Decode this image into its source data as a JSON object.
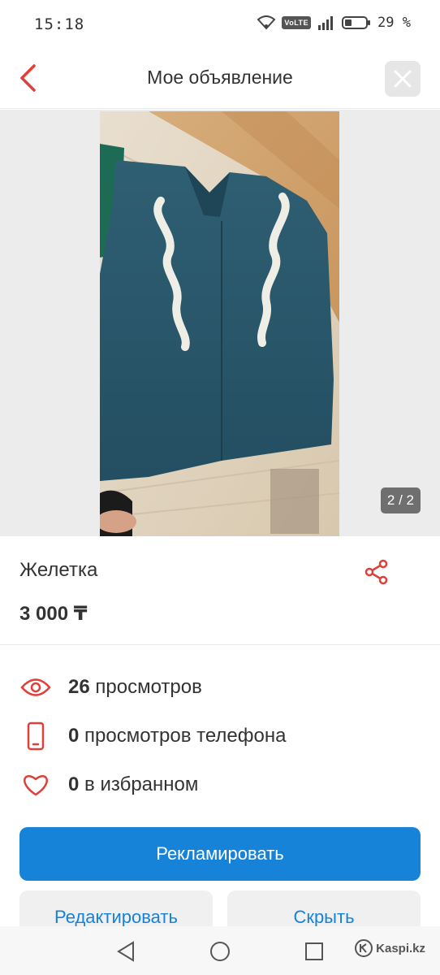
{
  "status_bar": {
    "time": "15:18",
    "network": "VoLTE",
    "battery": "29 %"
  },
  "header": {
    "title": "Мое объявление"
  },
  "photo": {
    "counter": "2 / 2",
    "watermark": "Kaspi.kz"
  },
  "item": {
    "title": "Желетка",
    "price": "3 000 ₸"
  },
  "stats": {
    "views": {
      "count": "26",
      "label": "просмотров"
    },
    "phone_views": {
      "count": "0",
      "label": "просмотров телефона"
    },
    "favorites": {
      "count": "0",
      "label": "в избранном"
    }
  },
  "actions": {
    "promote": "Рекламировать",
    "edit": "Редактировать",
    "hide": "Скрыть"
  },
  "footer": {
    "watermark": "Kaspi.kz"
  },
  "colors": {
    "accent_red": "#e0403a",
    "primary_blue": "#1682d8"
  },
  "icons": [
    "back-arrow-icon",
    "close-icon",
    "share-icon",
    "eye-icon",
    "phone-icon",
    "heart-icon",
    "nav-back-icon",
    "nav-home-icon",
    "nav-recents-icon"
  ]
}
